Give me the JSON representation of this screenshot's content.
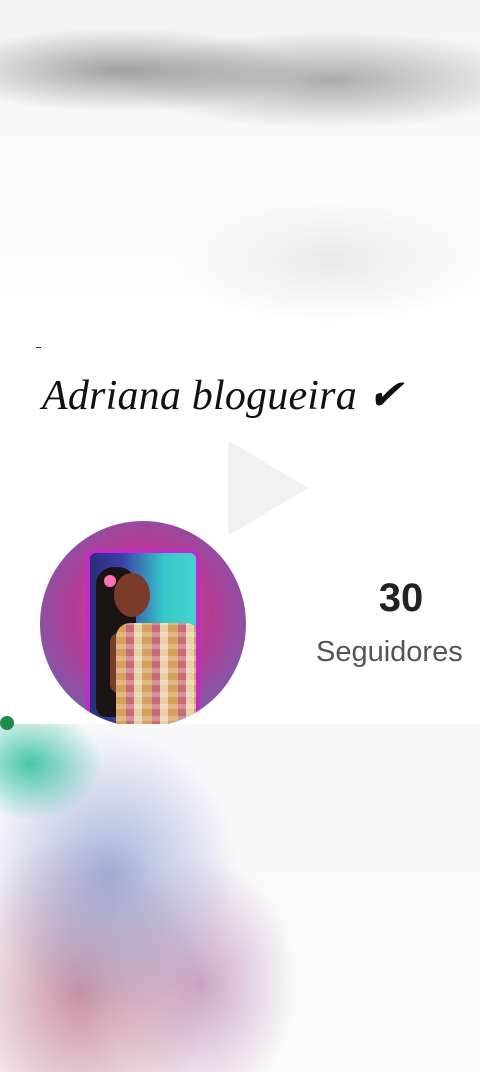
{
  "profile": {
    "name": "Adriana blogueira ✔",
    "followers_count": "30",
    "followers_label": "Seguidores"
  },
  "colors": {
    "avatar_ring": "#b43a94",
    "photo_border": "#c32acb"
  }
}
